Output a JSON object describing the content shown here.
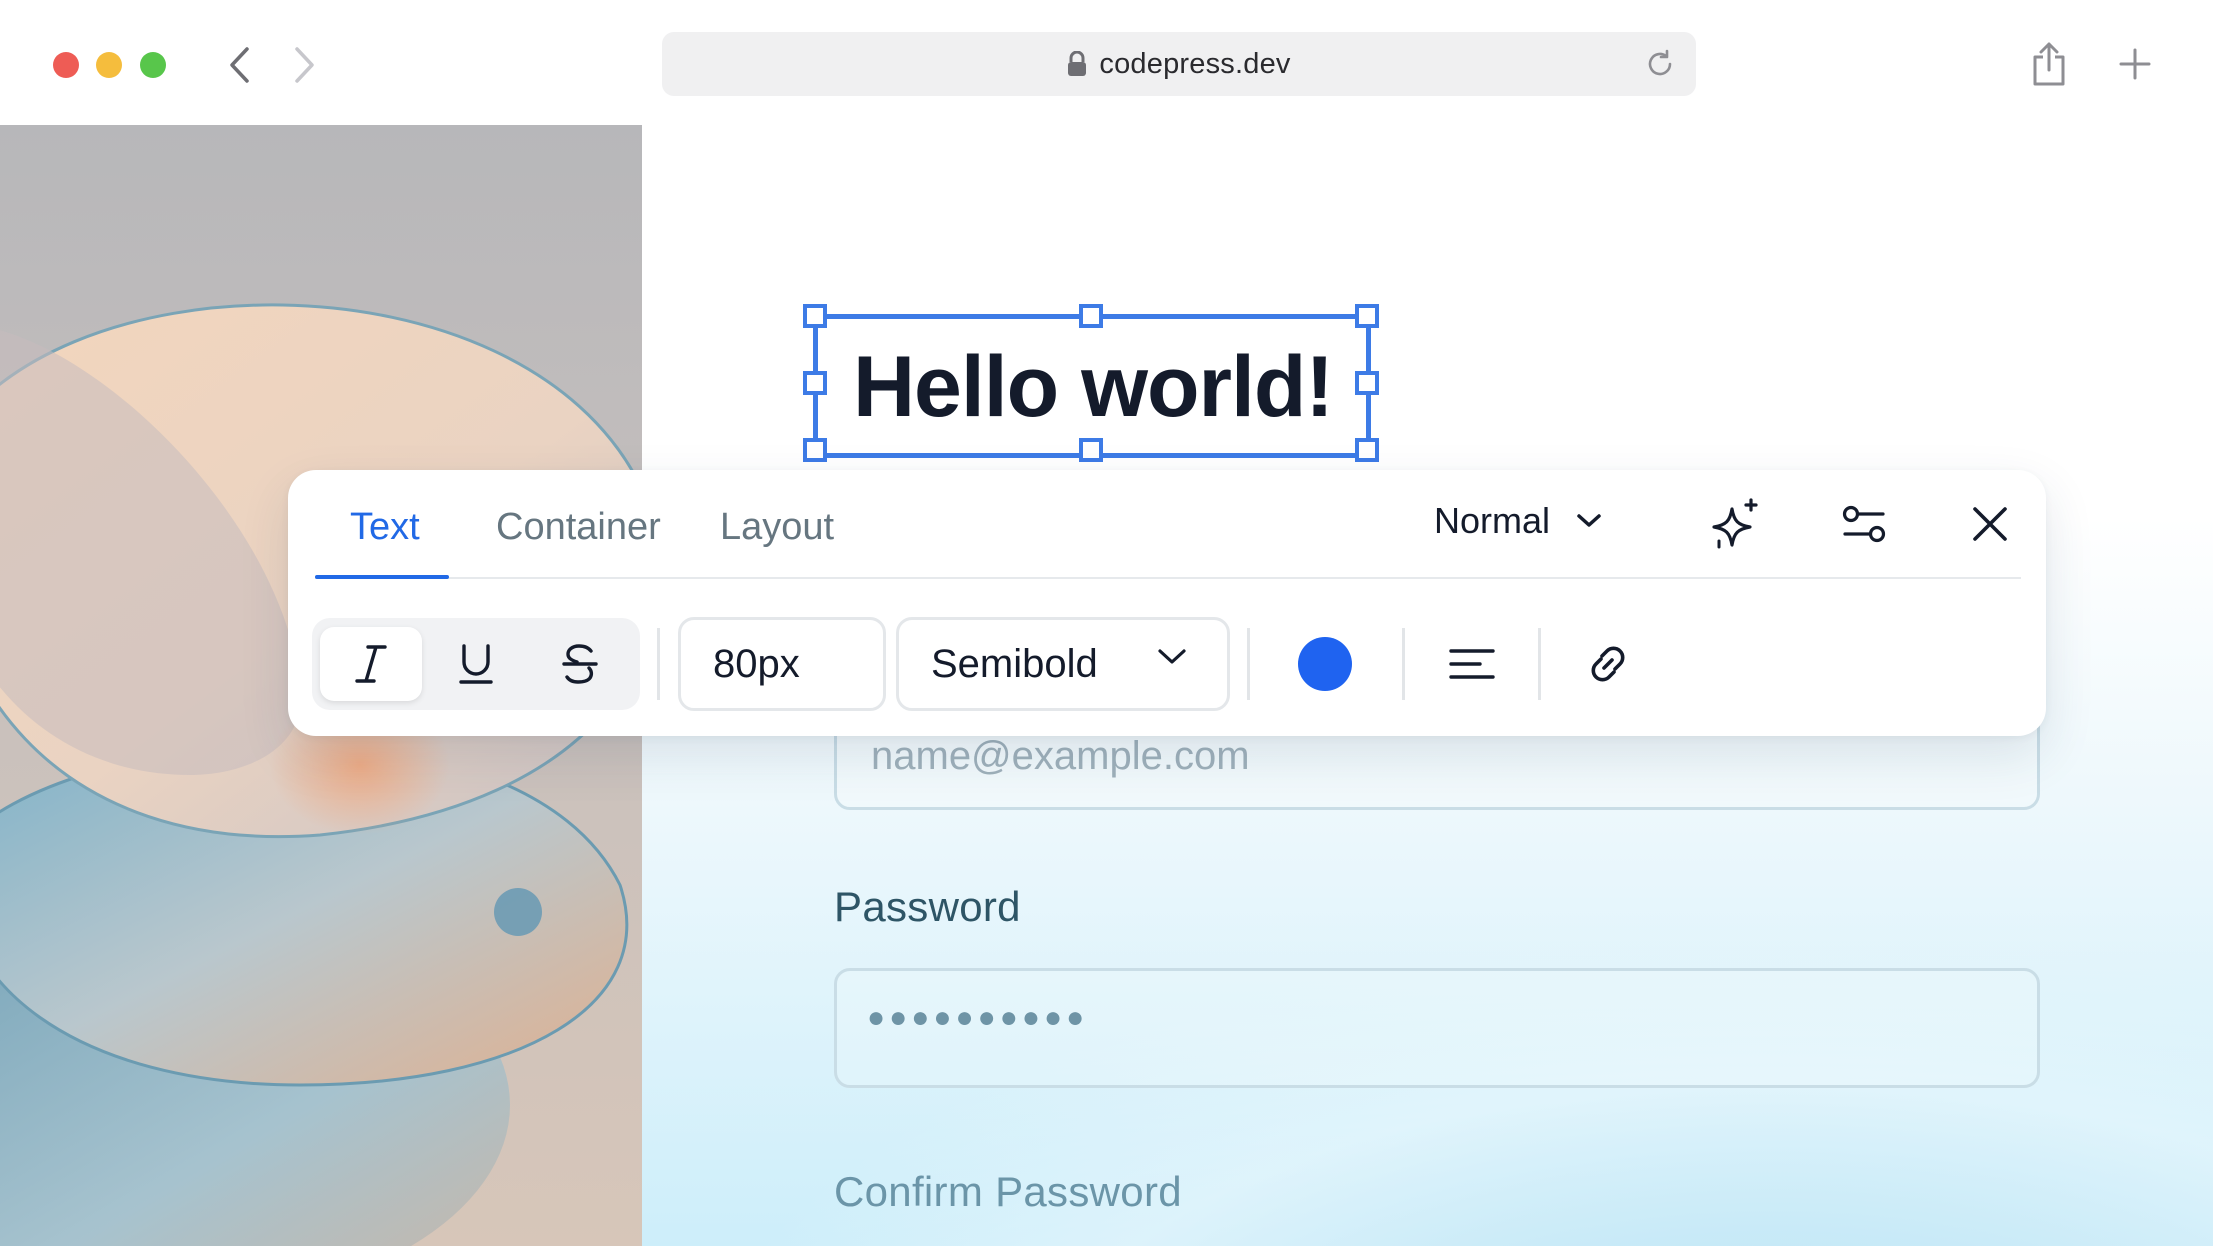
{
  "browser": {
    "url": "codepress.dev",
    "traffic_lights": {
      "close": "#ee5c55",
      "minimize": "#f5bd3d",
      "zoom": "#58c64b"
    }
  },
  "page": {
    "headline": "Hello world!",
    "email": {
      "placeholder": "name@example.com"
    },
    "password": {
      "label": "Password",
      "value_masked": "●●●●●●●●●●"
    },
    "confirm_password": {
      "label": "Confirm Password"
    }
  },
  "toolbar": {
    "tabs": [
      {
        "label": "Text",
        "active": true
      },
      {
        "label": "Container",
        "active": false
      },
      {
        "label": "Layout",
        "active": false
      }
    ],
    "mode": "Normal",
    "font_size": "80px",
    "font_weight": "Semibold",
    "text_color": "#1f63f0",
    "selected_style": "italic"
  },
  "colors": {
    "accent": "#2169e6",
    "selection": "#3d7be6",
    "headline": "#141b2b"
  }
}
